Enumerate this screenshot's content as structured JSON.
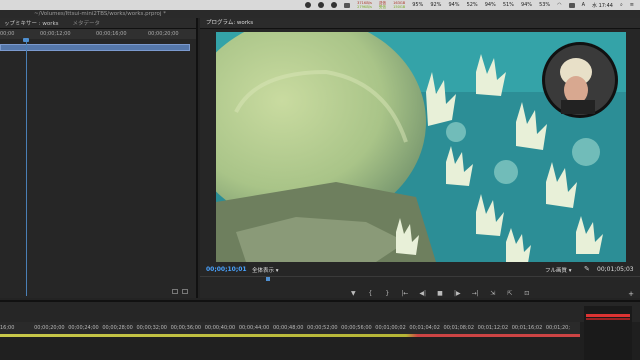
{
  "menubar": {
    "net_up": "371KB/s",
    "net_down": "279KB/s",
    "net_label_up": "送信",
    "net_label_down": "受信",
    "mem1": "163GB",
    "mem2": "150GB",
    "stats": [
      "95%",
      "92%",
      "94%",
      "52%",
      "94%",
      "51%",
      "94%",
      "53%"
    ],
    "user_initial": "A",
    "clock": "水 17:44"
  },
  "path": "~/Volumes/Ittsui-mini2TBS/works/works.prproj *",
  "source": {
    "tabs": [
      "ップミキサー : works",
      "メタデータ"
    ],
    "ruler": [
      "00;00",
      "00;00;12;00",
      "00;00;16;00",
      "00;00;20;00"
    ]
  },
  "program": {
    "tab": "プログラム: works",
    "timecode_left": "00;00;10;01",
    "fit": "全体表示",
    "quality": "フル画質",
    "timecode_right": "00;01;05;03",
    "transport": [
      "▼",
      "{",
      "}",
      "|←",
      "◀|",
      "■",
      "|▶",
      "→|",
      "⇲",
      "⇱",
      "⊡"
    ],
    "add": "+"
  },
  "timeline": {
    "ruler": [
      "16;00",
      "00;00;20;00",
      "00;00;24;00",
      "00;00;28;00",
      "00;00;32;00",
      "00;00;36;00",
      "00;00;40;00",
      "00;00;44;00",
      "00;00;48;00",
      "00;00;52;00",
      "00;00;56;00",
      "00;01;00;02",
      "00;01;04;02",
      "00;01;08;02",
      "00;01;12;02",
      "00;01;16;02",
      "00;01;20;"
    ]
  },
  "colors": {
    "accent": "#4aa3ff",
    "clip_blue": "#5577aa",
    "meter_red": "#d33"
  },
  "icons": [
    "apple-icon",
    "wifi-icon",
    "battery-icon",
    "search-icon",
    "wrench-icon"
  ]
}
